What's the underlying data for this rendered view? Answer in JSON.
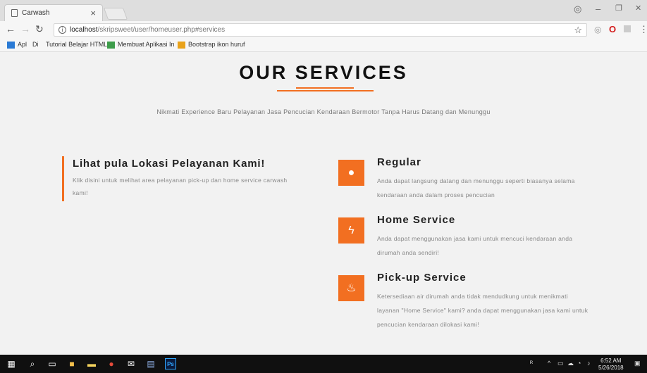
{
  "browser": {
    "tab_title": "Carwash",
    "tab_close": "×",
    "url_host": "localhost",
    "url_path": "/skripsweet/user/homeuser.php#services",
    "info_icon": "i",
    "star": "☆",
    "win_min": "–",
    "win_max": "❐",
    "win_close": "✕",
    "account": "◎",
    "ext_vert": "⋮",
    "bookmarks": [
      {
        "label": "Apl",
        "color": "#2a7ad5"
      },
      {
        "label": "Di",
        "color": "#6a6a6a"
      },
      {
        "label": "Tutorial Belajar HTML",
        "color": "#cccccc"
      },
      {
        "label": "Membuat Aplikasi In",
        "color": "#3d9c4a"
      },
      {
        "label": "Bootstrap ikon huruf",
        "color": "#e9a21a"
      }
    ]
  },
  "section": {
    "title": "OUR SERVICES",
    "subtitle": "Nikmati Experience Baru Pelayanan Jasa Pencucian Kendaraan Bermotor Tanpa Harus Datang dan Menunggu",
    "accent": "#f26f21"
  },
  "location": {
    "heading": "Lihat pula Lokasi Pelayanan Kami!",
    "text": "Klik disini untuk melihat area pelayanan pick-up dan home service carwash kami!"
  },
  "services": [
    {
      "icon": "lightbulb-icon",
      "glyph": "💡",
      "title": "Regular",
      "text": "Anda dapat langsung datang dan menunggu seperti biasanya selama kendaraan anda dalam proses pencucian"
    },
    {
      "icon": "bolt-icon",
      "glyph": "⚡",
      "title": "Home Service",
      "text": "Anda dapat menggunakan jasa kami untuk mencuci kendaraan anda dirumah anda sendiri!"
    },
    {
      "icon": "fire-icon",
      "glyph": "🔥",
      "title": "Pick-up Service",
      "text": "Ketersediaan air dirumah anda tidak mendudkung untuk menikmati layanan \"Home Service\" kami? anda dapat menggunakan jasa kami untuk pencucian kendaraan dilokasi kami!"
    }
  ],
  "taskbar": {
    "time": "6:52 AM",
    "date": "5/26/2018",
    "ps_label": "Ps"
  }
}
